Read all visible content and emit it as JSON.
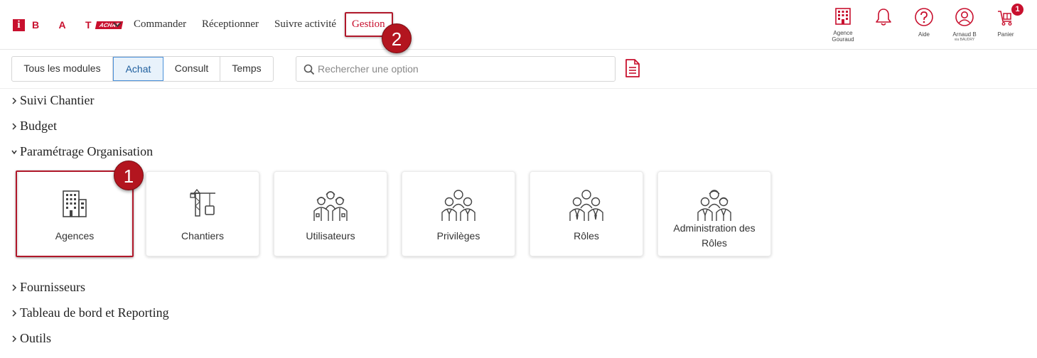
{
  "brand": {
    "letter": "i",
    "name": "B A T",
    "module_badge": "ACHAT"
  },
  "nav": [
    {
      "label": "Commander"
    },
    {
      "label": "Réceptionner"
    },
    {
      "label": "Suivre activité"
    },
    {
      "label": "Gestion",
      "active": true
    }
  ],
  "right_icons": {
    "agency": {
      "line1": "Agence",
      "line2": "Gouraud",
      "icon": "building-icon"
    },
    "notifications": {
      "icon": "bell-icon"
    },
    "help": {
      "label": "Aide",
      "icon": "question-icon"
    },
    "user": {
      "label": "Arnaud B",
      "sub": "via BAUDRY",
      "icon": "user-icon"
    },
    "cart": {
      "label": "Panier",
      "count": "1",
      "icon": "cart-icon"
    }
  },
  "module_tabs": [
    {
      "label": "Tous les modules"
    },
    {
      "label": "Achat",
      "selected": true
    },
    {
      "label": "Consult"
    },
    {
      "label": "Temps"
    }
  ],
  "search": {
    "placeholder": "Rechercher une option",
    "value": ""
  },
  "sections": [
    {
      "label": "Suivi Chantier",
      "expanded": false
    },
    {
      "label": "Budget",
      "expanded": false
    },
    {
      "label": "Paramétrage Organisation",
      "expanded": true
    },
    {
      "label": "Fournisseurs",
      "expanded": false
    },
    {
      "label": "Tableau de bord et Reporting",
      "expanded": false
    },
    {
      "label": "Outils",
      "expanded": false
    }
  ],
  "cards": [
    {
      "label": "Agences",
      "icon": "building-icon"
    },
    {
      "label": "Chantiers",
      "icon": "crane-icon"
    },
    {
      "label": "Utilisateurs",
      "icon": "workers-icon"
    },
    {
      "label": "Privilèges",
      "icon": "people-icon"
    },
    {
      "label": "Rôles",
      "icon": "roles-icon"
    },
    {
      "label_line1": "Administration des",
      "label_line2": "Rôles",
      "icon": "admin-roles-icon"
    }
  ],
  "annotations": [
    {
      "number": "1"
    },
    {
      "number": "2"
    }
  ],
  "colors": {
    "brand": "#c8102e",
    "annotation": "#b3151f",
    "tab_selected_bg": "#e8f2fb",
    "tab_selected_border": "#4a90d9"
  }
}
